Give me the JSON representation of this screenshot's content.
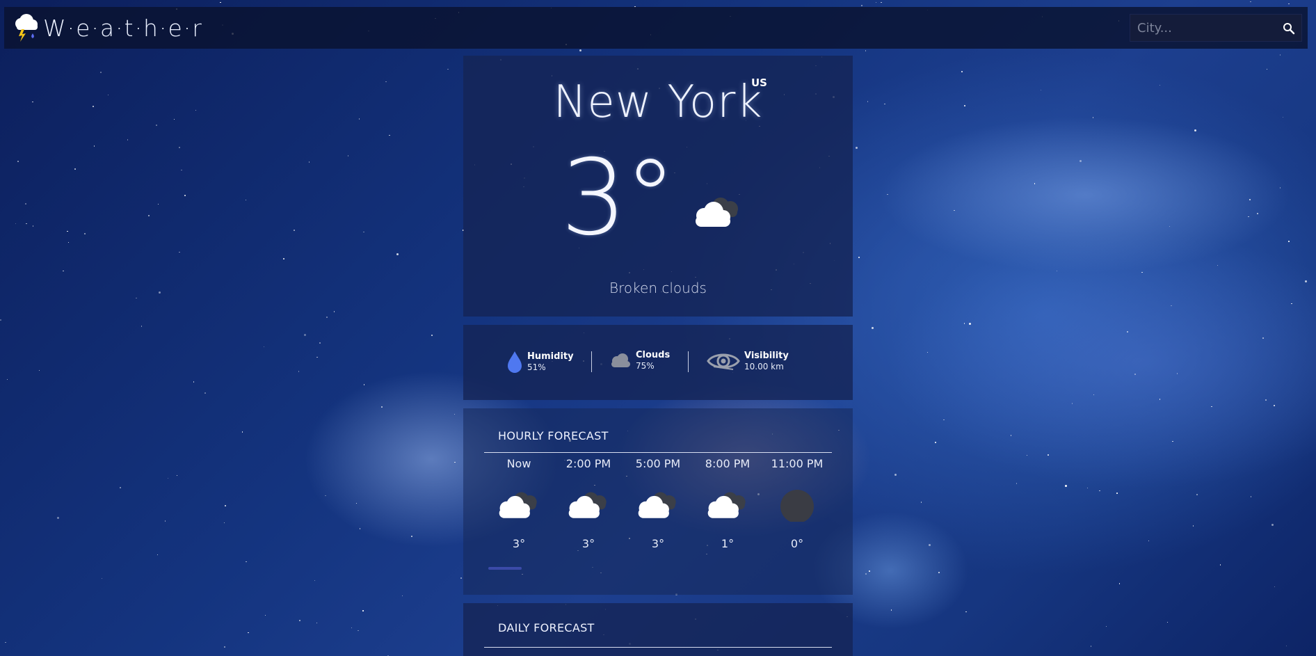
{
  "app": {
    "title": "W·e·a·t·h·e·r",
    "logo_icon": "storm-cloud-icon"
  },
  "search": {
    "placeholder": "City...",
    "icon": "search-icon"
  },
  "current": {
    "city": "New York",
    "country": "US",
    "temperature": "3°",
    "condition_icon": "broken-clouds-icon",
    "description": "Broken clouds"
  },
  "stats": [
    {
      "label": "Humidity",
      "value": "51%",
      "icon": "water-drop-icon",
      "color": "#4f78f0"
    },
    {
      "label": "Clouds",
      "value": "75%",
      "icon": "cloud-icon",
      "color": "#8a8f9c"
    },
    {
      "label": "Visibility",
      "value": "10.00 km",
      "icon": "eye-icon",
      "color": "#9aa0ad"
    }
  ],
  "hourly": {
    "title": "HOURLY FORECAST",
    "items": [
      {
        "time": "Now",
        "temp": "3°",
        "icon": "broken-clouds-icon"
      },
      {
        "time": "2:00 PM",
        "temp": "3°",
        "icon": "broken-clouds-icon"
      },
      {
        "time": "5:00 PM",
        "temp": "3°",
        "icon": "broken-clouds-icon"
      },
      {
        "time": "8:00 PM",
        "temp": "1°",
        "icon": "broken-clouds-icon"
      },
      {
        "time": "11:00 PM",
        "temp": "0°",
        "icon": "clear-night-icon"
      }
    ]
  },
  "daily": {
    "title": "DAILY FORECAST"
  },
  "colors": {
    "accent": "#3b4aa8",
    "card": "#142454"
  }
}
